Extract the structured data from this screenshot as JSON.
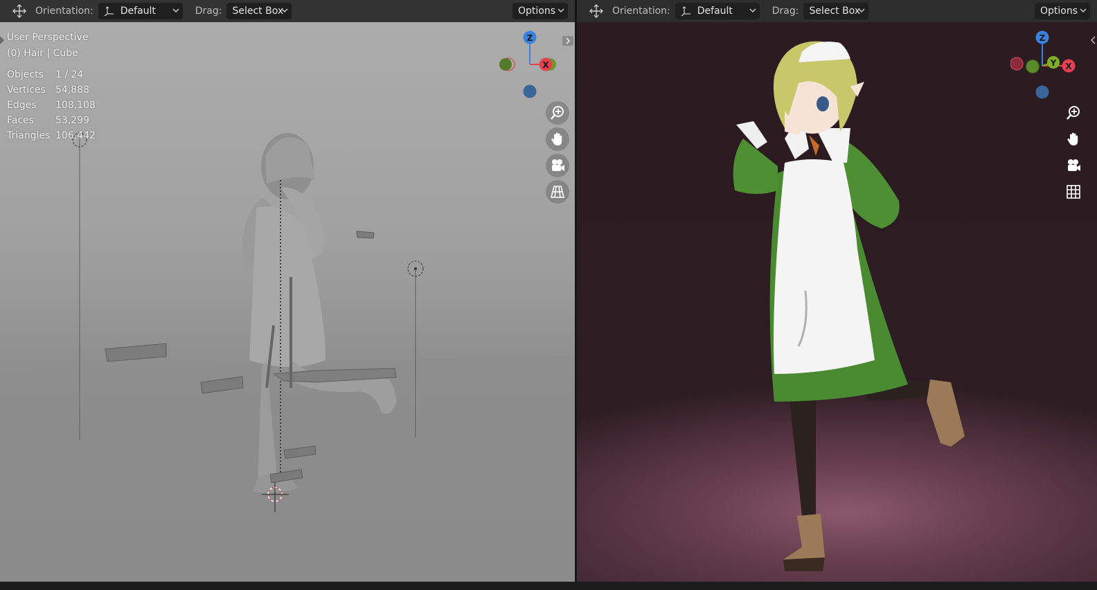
{
  "left_viewport": {
    "header": {
      "orientation_label": "Orientation:",
      "orientation_value": "Default",
      "drag_label": "Drag:",
      "drag_value": "Select Box",
      "options_label": "Options"
    },
    "view_name": "User Perspective",
    "active_object": "(0) Hair | Cube",
    "stats": [
      {
        "label": "Objects",
        "value": "1 / 24"
      },
      {
        "label": "Vertices",
        "value": "54,888"
      },
      {
        "label": "Edges",
        "value": "108,108"
      },
      {
        "label": "Faces",
        "value": "53,299"
      },
      {
        "label": "Triangles",
        "value": "106,442"
      }
    ],
    "gizmo_labels": {
      "z": "Z",
      "x": "X"
    },
    "nav_icons": [
      "zoom-icon",
      "pan-hand-icon",
      "camera-icon",
      "perspective-grid-icon"
    ]
  },
  "right_viewport": {
    "header": {
      "orientation_label": "Orientation:",
      "orientation_value": "Default",
      "drag_label": "Drag:",
      "drag_value": "Select Box",
      "options_label": "Options"
    },
    "gizmo_labels": {
      "z": "Z",
      "y": "Y",
      "x": "X"
    },
    "nav_icons": [
      "zoom-icon",
      "pan-hand-icon",
      "camera-icon",
      "ortho-grid-icon"
    ]
  },
  "colors": {
    "axis_x": "#e5404f",
    "axis_y": "#7fb020",
    "axis_z": "#3b82e0",
    "header_bg": "#2e2e2e",
    "dropdown_bg": "#1f1f1f"
  }
}
